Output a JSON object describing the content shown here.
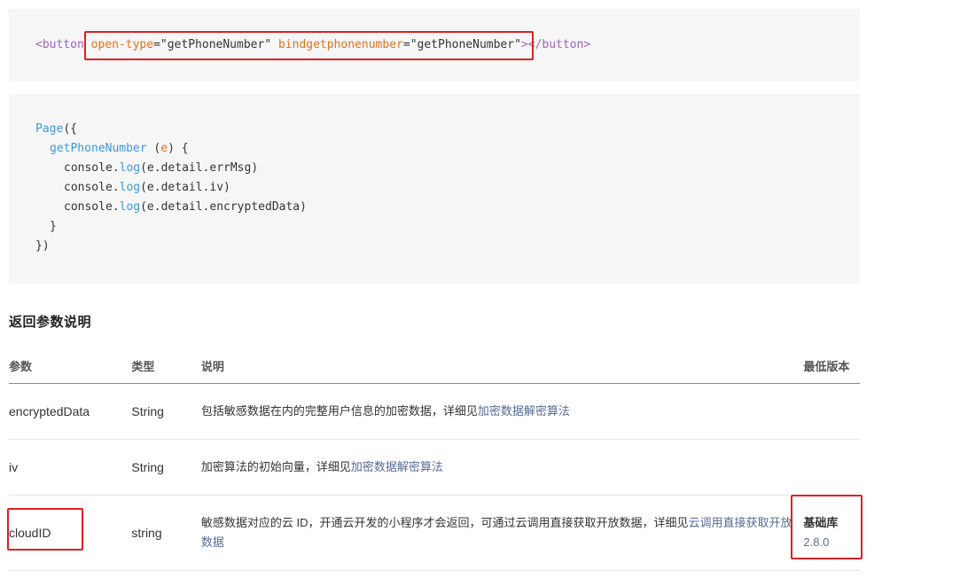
{
  "code_snippet_1": {
    "tag_open": "<button",
    "attr1_name": "open-type",
    "eq": "=",
    "attr1_value": "\"getPhoneNumber\"",
    "attr2_name": "bindgetphonenumber",
    "attr2_value": "\"getPhoneNumber\"",
    "tag_close_bracket": ">",
    "tag_end": "</button>"
  },
  "code_snippet_2": {
    "line1_fn": "Page",
    "line1_rest": "({",
    "line2_fn": "getPhoneNumber",
    "line2_open": " (",
    "line2_param": "e",
    "line2_close": ") {",
    "line3_a": "console.",
    "line3_fn": "log",
    "line3_b": "(e.detail.errMsg)",
    "line4_a": "console.",
    "line4_fn": "log",
    "line4_b": "(e.detail.iv)",
    "line5_a": "console.",
    "line5_fn": "log",
    "line5_b": "(e.detail.encryptedData)",
    "line6": "}",
    "line7": "})"
  },
  "section": {
    "title": "返回参数说明"
  },
  "table": {
    "headers": {
      "param": "参数",
      "type": "类型",
      "desc": "说明",
      "version": "最低版本"
    },
    "rows": [
      {
        "name": "encryptedData",
        "type": "String",
        "desc": "包括敏感数据在内的完整用户信息的加密数据，详细见",
        "link": "加密数据解密算法",
        "version_label": "",
        "version_num": ""
      },
      {
        "name": "iv",
        "type": "String",
        "desc": "加密算法的初始向量，详细见",
        "link": "加密数据解密算法",
        "version_label": "",
        "version_num": ""
      },
      {
        "name": "cloudID",
        "type": "string",
        "desc": "敏感数据对应的云 ID，开通云开发的小程序才会返回，可通过云调用直接获取开放数据，详细见",
        "link": "云调用直接获取开放数据",
        "version_label": "基础库",
        "version_num": "2.8.0"
      }
    ]
  },
  "colors": {
    "highlight_box": "#e02020",
    "link": "#576b95",
    "code_background": "#f6f6f6"
  }
}
